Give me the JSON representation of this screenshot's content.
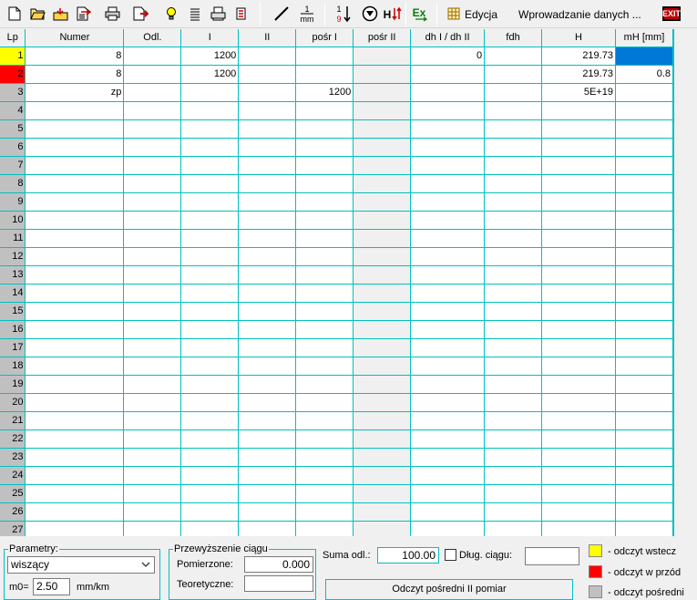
{
  "toolbar": {
    "icons": [
      "new-file",
      "open-folder",
      "import",
      "export",
      "print",
      "export-red",
      "bulb",
      "list",
      "print2",
      "stack"
    ],
    "icons2": [
      "line",
      "mm-scale",
      "sort",
      "filter",
      "h-sort",
      "excel"
    ],
    "edit_label": "Edycja",
    "mode_label": "Wprowadzanie danych ...",
    "exit_label": "EXIT"
  },
  "grid": {
    "columns": [
      "Lp",
      "Numer",
      "Odl.",
      "I",
      "II",
      "pośr I",
      "pośr II",
      "dh I / dh II",
      "fdh",
      "H",
      "mH [mm]"
    ],
    "rows": [
      {
        "lp": "1",
        "numer": "8",
        "odl": "",
        "i": "1200",
        "ii": "",
        "posr1": "",
        "posr2": "",
        "dh": "0",
        "fdh": "",
        "h": "219.73",
        "mh": ""
      },
      {
        "lp": "2",
        "numer": "8",
        "odl": "",
        "i": "1200",
        "ii": "",
        "posr1": "",
        "posr2": "",
        "dh": "",
        "fdh": "",
        "h": "219.73",
        "mh": "0.8"
      },
      {
        "lp": "3",
        "numer": "zp",
        "odl": "",
        "i": "",
        "ii": "",
        "posr1": "1200",
        "posr2": "",
        "dh": "",
        "fdh": "",
        "h": "5E+19",
        "mh": ""
      },
      {
        "lp": "4"
      },
      {
        "lp": "5"
      },
      {
        "lp": "6"
      },
      {
        "lp": "7"
      },
      {
        "lp": "8"
      },
      {
        "lp": "9"
      },
      {
        "lp": "10"
      },
      {
        "lp": "11"
      },
      {
        "lp": "12"
      },
      {
        "lp": "13"
      },
      {
        "lp": "14"
      },
      {
        "lp": "15"
      },
      {
        "lp": "16"
      },
      {
        "lp": "17"
      },
      {
        "lp": "18"
      },
      {
        "lp": "19"
      },
      {
        "lp": "20"
      },
      {
        "lp": "21"
      },
      {
        "lp": "22"
      },
      {
        "lp": "23"
      },
      {
        "lp": "24"
      },
      {
        "lp": "25"
      },
      {
        "lp": "26"
      },
      {
        "lp": "27"
      }
    ],
    "row_marks": {
      "1": "yellow",
      "2": "red"
    }
  },
  "params": {
    "title": "Parametry:",
    "type_value": "wiszący",
    "m0_label": "m0=",
    "m0_value": "2.50",
    "m0_unit": "mm/km"
  },
  "elevation": {
    "title": "Przewyższenie ciągu",
    "measured_label": "Pomierzone:",
    "measured_value": "0.000",
    "theoretical_label": "Teoretyczne:",
    "theoretical_value": ""
  },
  "summary": {
    "sum_label": "Suma odl.:",
    "sum_value": "100.00",
    "length_label": "Dług. ciągu:",
    "length_value": "",
    "button_label": "Odczyt pośredni II pomiar"
  },
  "legend": {
    "items": [
      {
        "color": "#ffff00",
        "label": "- odczyt wstecz"
      },
      {
        "color": "#ff0000",
        "label": "- odczyt w przód"
      },
      {
        "color": "#c0c0c0",
        "label": "- odczyt pośredni"
      }
    ]
  }
}
